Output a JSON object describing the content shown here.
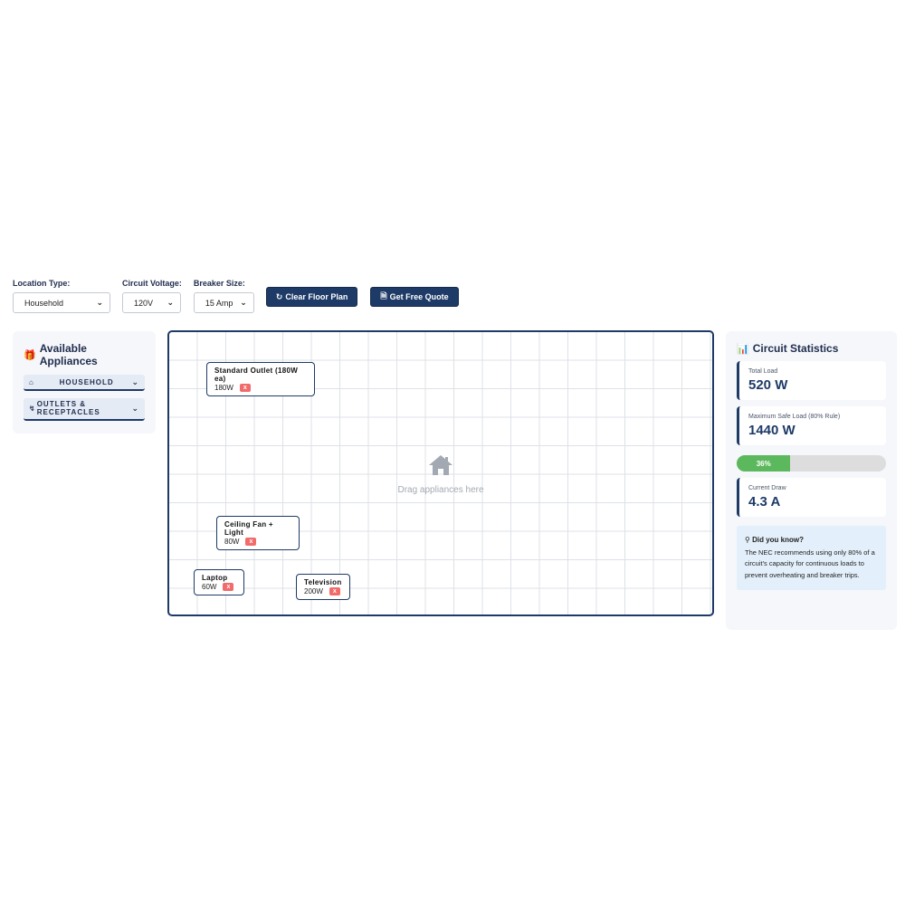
{
  "controls": {
    "location_label": "Location Type:",
    "location_value": "Household",
    "voltage_label": "Circuit Voltage:",
    "voltage_value": "120V",
    "breaker_label": "Breaker Size:",
    "breaker_value": "15 Amp",
    "clear_label": "Clear Floor Plan",
    "quote_label": "Get Free Quote"
  },
  "appliances_panel": {
    "title": "Available Appliances",
    "categories": [
      {
        "label": "HOUSEHOLD",
        "icon": "home-icon"
      },
      {
        "label": "OUTLETS & RECEPTACLES",
        "icon": "plug-icon"
      }
    ]
  },
  "floor_plan": {
    "placeholder": "Drag appliances here",
    "remove_label": "x",
    "items": [
      {
        "name": "Standard Outlet (180W ea)",
        "watts": "180W"
      },
      {
        "name": "Ceiling Fan + Light",
        "watts": "80W"
      },
      {
        "name": "Laptop",
        "watts": "60W"
      },
      {
        "name": "Television",
        "watts": "200W"
      }
    ]
  },
  "stats": {
    "title": "Circuit Statistics",
    "total_load_label": "Total Load",
    "total_load_value": "520 W",
    "max_safe_label": "Maximum Safe Load (80% Rule)",
    "max_safe_value": "1440 W",
    "usage_percent": 36,
    "usage_label": "36%",
    "current_draw_label": "Current Draw",
    "current_draw_value": "4.3 A",
    "tip_title": "Did you know?",
    "tip_text": "The NEC recommends using only 80% of a circuit's capacity for continuous loads to prevent overheating and breaker trips."
  },
  "colors": {
    "primary": "#1e3a66",
    "progress": "#5cb85c",
    "remove": "#f26b6b",
    "tip_bg": "#e3f0fb"
  }
}
